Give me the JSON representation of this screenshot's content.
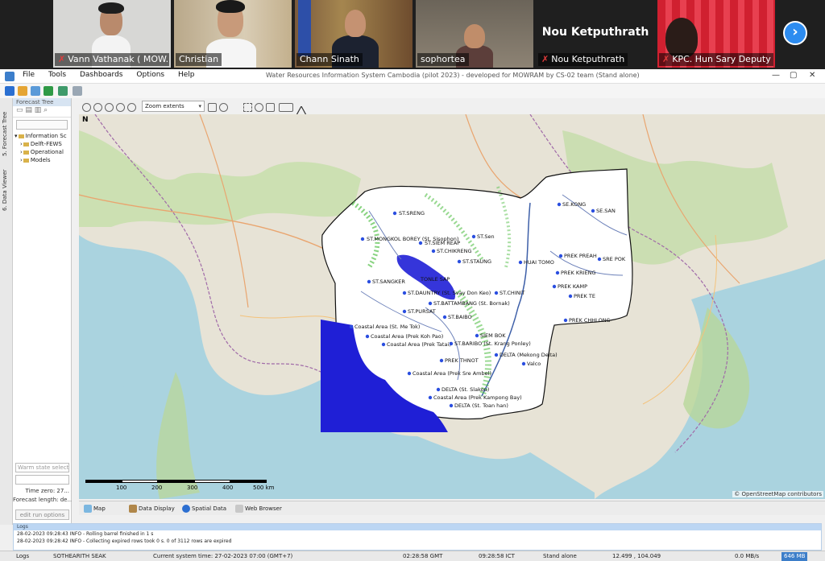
{
  "meeting": {
    "participants": [
      {
        "name": "Vann Vathanak ( MOW...",
        "muted": true
      },
      {
        "name": "Christian",
        "muted": false
      },
      {
        "name": "Chann Sinath",
        "muted": false
      },
      {
        "name": "sophortea",
        "muted": false
      },
      {
        "name": "Nou Ketputhrath",
        "muted": true,
        "headline": "Nou Ketputhrath"
      },
      {
        "name": "KPC. Hun Sary Deputy ...",
        "muted": true
      }
    ],
    "next_icon": "chevron-right-icon"
  },
  "app": {
    "menu": [
      "File",
      "Tools",
      "Dashboards",
      "Options",
      "Help"
    ],
    "title": "Water Resources Information System Cambodia (pilot 2023) - developed for MOWRAM by CS-02 team  (Stand alone)",
    "window_controls": [
      "—",
      "▢",
      "✕"
    ]
  },
  "left": {
    "vertical_tabs": [
      "5. Forecast Tree",
      "6. Data Viewer"
    ],
    "panel_title": "Forecast Tree",
    "tree": [
      {
        "label": "Information Sc",
        "level": 0
      },
      {
        "label": "Delft-FEWS",
        "level": 1
      },
      {
        "label": "Operational",
        "level": 1
      },
      {
        "label": "Models",
        "level": 1
      }
    ],
    "warm_state_placeholder": "Warm state select...",
    "time_zero": "Time zero:  27...",
    "forecast_length": "Forecast length:  de...",
    "edit_run_options": "edit run options"
  },
  "maptoolbar": {
    "zoom_value": "Zoom extents"
  },
  "map": {
    "north": "N",
    "attribution": "© OpenStreetMap contributors",
    "scale_labels": [
      "100",
      "200",
      "300",
      "400",
      "500 km"
    ],
    "stations": [
      "ST.SRENG",
      "ST.MONGKOL BOREY (St. Sisophon)",
      "ST.SIEM REAP",
      "ST.Sen",
      "ST.CHIKRENG",
      "ST.STAUNG",
      "TONLE SAP",
      "ST.SANGKER",
      "ST.DAUNTRY (St. Svay Don Keo)",
      "ST.CHINIT",
      "ST.BATTAMBANG (St. Bornak)",
      "ST.PURSAT",
      "ST.BAIBO",
      "Coastal Area (St. Me Tok)",
      "Coastal Area (Prek Koh Pao)",
      "SIEM BOK",
      "Coastal Area (Prek Tatai)",
      "ST.BARIBO (St. Krang Ponley)",
      "DELTA (Mekong Delta)",
      "PREK THNOT",
      "Valco",
      "Coastal Area (Prek Sre Ambel)",
      "DELTA (St. Slakou)",
      "Coastal Area (Prek Kampong Bay)",
      "DELTA (St. Toan han)",
      "SE.KONG",
      "SE.SAN",
      "PREK PREAH",
      "SRE POK",
      "PREK KRIENG",
      "PREK KAMP",
      "PREK TE",
      "PREK CHHLONG",
      "HUAI TOMO"
    ]
  },
  "tabs": [
    "Map",
    "Data Display",
    "Spatial Data",
    "Web Browser"
  ],
  "logs": {
    "title": "Logs",
    "lines": [
      "28-02-2023 09:28:43 INFO - Rolling barrel finished in 1 s",
      "28-02-2023 09:28:42 INFO - Collecting expired rows took 0 s. 0 of 3112 rows are expired"
    ]
  },
  "status": {
    "logs_tab": "Logs",
    "user": "SOTHEARITH SEAK",
    "system_time": "Current system time: 27-02-2023 07:00 (GMT+7)",
    "gmt": "02:28:58 GMT",
    "ict": "09:28:58 ICT",
    "mode": "Stand alone",
    "coords": "12.499 , 104.049",
    "net": "0.0 MB/s",
    "mem": "646 MB"
  },
  "colors": {
    "accent": "#2d8cf0",
    "water": "#1f1fd6",
    "forest": "#8cc46b"
  }
}
